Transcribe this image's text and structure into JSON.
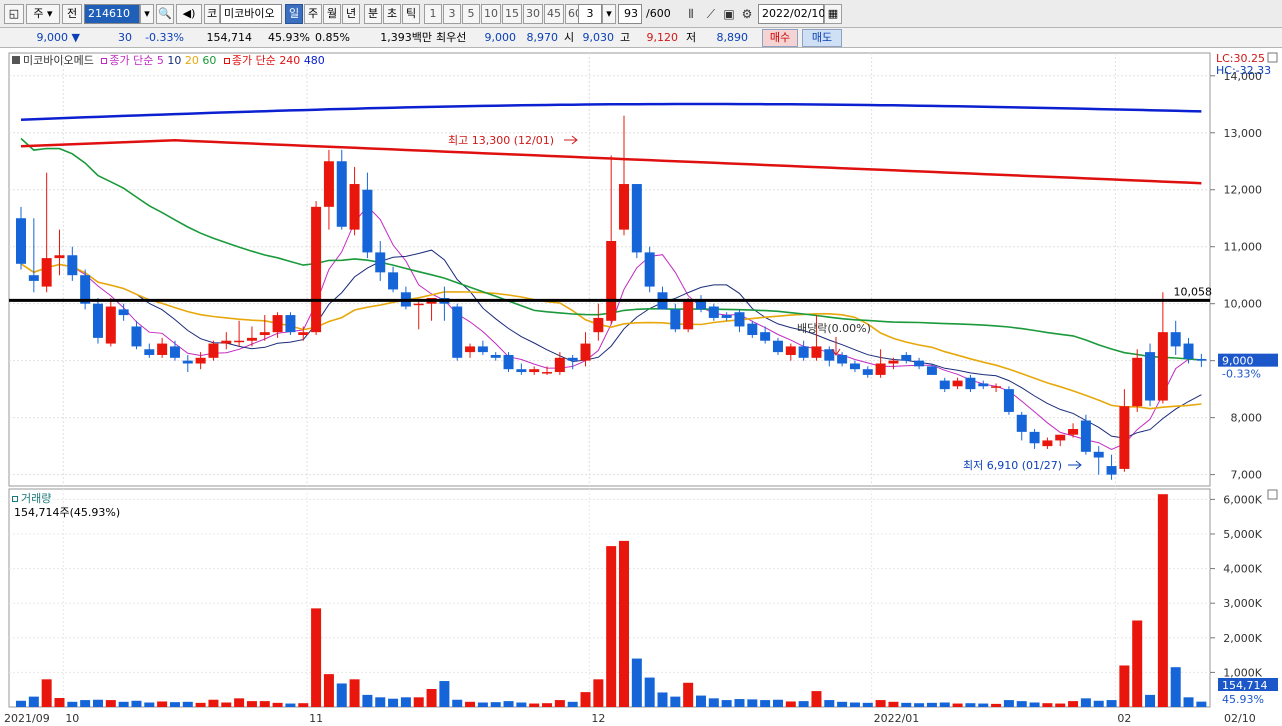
{
  "toolbar": {
    "mode_label": "주",
    "prev_label": "전",
    "stock_code": "214610",
    "market_label": "코",
    "stock_name": "미코바이오",
    "periods": [
      "일",
      "주",
      "월",
      "년",
      "분",
      "초",
      "틱"
    ],
    "selected_period": "일",
    "intervals": [
      "1",
      "3",
      "5",
      "10",
      "15",
      "30",
      "45",
      "60"
    ],
    "interval_value": "3",
    "count_value": "93",
    "count_total": "/600",
    "date": "2022/02/10"
  },
  "quote": {
    "price": "9,000",
    "change_arrow": "▼",
    "change": "30",
    "change_pct": "-0.33%",
    "volume": "154,714",
    "volume_ratio": "45.93%",
    "turnover": "0.85%",
    "amount": "1,393백만",
    "ask_label": "최우선",
    "ask1": "9,000",
    "ask2": "8,970",
    "open_label": "시",
    "open": "9,030",
    "high_label": "고",
    "high": "9,120",
    "low_label": "저",
    "low": "8,890",
    "buy_label": "매수",
    "sell_label": "매도"
  },
  "legend": {
    "name": "미코바이오메드",
    "ma_short_label": "종가 단순",
    "ma_short_periods": [
      "5",
      "10",
      "20",
      "60"
    ],
    "ma_long_label": "종가 단순",
    "ma_long_periods": [
      "240",
      "480"
    ],
    "lc": "LC:30.25",
    "hc": "HC:-32.33",
    "volume_title": "거래량",
    "volume_value": "154,714주(45.93%)"
  },
  "annotations": {
    "high": "최고 13,300 (12/01)",
    "low": "최저 6,910 (01/27)",
    "dividend": "배당락(0.00%)",
    "level_line": "10,058",
    "price_tag": "9,000",
    "price_tag_pct": "-0.33%",
    "vol_tag": "154,714",
    "vol_tag_pct": "45.93%"
  },
  "colors": {
    "up": "#e8160c",
    "down": "#1565d8",
    "ma5": "#c22bc2",
    "ma10": "#1a2b7a",
    "ma20": "#e8a80c",
    "ma60": "#1a9a3a",
    "ma240": "#e01010",
    "ma480": "#0b20d0"
  },
  "chart_data": {
    "type": "candlestick",
    "price_axis": {
      "ylim": [
        6800,
        14400
      ],
      "ticks": [
        7000,
        8000,
        9000,
        10000,
        11000,
        12000,
        13000,
        14000
      ]
    },
    "volume_axis": {
      "ylim": [
        0,
        6300
      ],
      "unit": "K",
      "ticks": [
        1000,
        2000,
        3000,
        4000,
        5000,
        6000
      ],
      "tick_labels": [
        "1,000K",
        "2,000K",
        "3,000K",
        "4,000K",
        "5,000K",
        "6,000K"
      ]
    },
    "date_labels": [
      {
        "index": 0,
        "label": "2021/09"
      },
      {
        "index": 4,
        "label": "10"
      },
      {
        "index": 23,
        "label": "11"
      },
      {
        "index": 45,
        "label": "12"
      },
      {
        "index": 67,
        "label": "2022/01"
      },
      {
        "index": 86,
        "label": "02"
      },
      {
        "index": 93,
        "label": "02/10"
      }
    ],
    "candles": [
      {
        "o": 11500,
        "h": 11700,
        "l": 10600,
        "c": 10700,
        "v": 180
      },
      {
        "o": 10500,
        "h": 11500,
        "l": 10200,
        "c": 10400,
        "v": 300
      },
      {
        "o": 10300,
        "h": 12300,
        "l": 10200,
        "c": 10800,
        "v": 800
      },
      {
        "o": 10800,
        "h": 11300,
        "l": 10500,
        "c": 10850,
        "v": 260
      },
      {
        "o": 10850,
        "h": 11000,
        "l": 10400,
        "c": 10500,
        "v": 150
      },
      {
        "o": 10500,
        "h": 10600,
        "l": 9900,
        "c": 10000,
        "v": 200
      },
      {
        "o": 10000,
        "h": 10100,
        "l": 9300,
        "c": 9400,
        "v": 210
      },
      {
        "o": 9300,
        "h": 10100,
        "l": 9250,
        "c": 9950,
        "v": 200
      },
      {
        "o": 9900,
        "h": 10000,
        "l": 9700,
        "c": 9800,
        "v": 150
      },
      {
        "o": 9600,
        "h": 9700,
        "l": 9200,
        "c": 9250,
        "v": 180
      },
      {
        "o": 9200,
        "h": 9300,
        "l": 9050,
        "c": 9100,
        "v": 130
      },
      {
        "o": 9100,
        "h": 9400,
        "l": 9050,
        "c": 9300,
        "v": 160
      },
      {
        "o": 9250,
        "h": 9350,
        "l": 9000,
        "c": 9050,
        "v": 140
      },
      {
        "o": 9000,
        "h": 9100,
        "l": 8800,
        "c": 8950,
        "v": 150
      },
      {
        "o": 8950,
        "h": 9150,
        "l": 8850,
        "c": 9050,
        "v": 120
      },
      {
        "o": 9050,
        "h": 9350,
        "l": 9000,
        "c": 9300,
        "v": 210
      },
      {
        "o": 9300,
        "h": 9500,
        "l": 9200,
        "c": 9350,
        "v": 130
      },
      {
        "o": 9350,
        "h": 9700,
        "l": 9250,
        "c": 9350,
        "v": 250
      },
      {
        "o": 9350,
        "h": 9600,
        "l": 9250,
        "c": 9400,
        "v": 170
      },
      {
        "o": 9450,
        "h": 9800,
        "l": 9350,
        "c": 9500,
        "v": 170
      },
      {
        "o": 9500,
        "h": 9850,
        "l": 9400,
        "c": 9800,
        "v": 120
      },
      {
        "o": 9800,
        "h": 9850,
        "l": 9450,
        "c": 9500,
        "v": 100
      },
      {
        "o": 9450,
        "h": 9600,
        "l": 9350,
        "c": 9500,
        "v": 110
      },
      {
        "o": 9500,
        "h": 11800,
        "l": 9450,
        "c": 11700,
        "v": 2850
      },
      {
        "o": 11700,
        "h": 12700,
        "l": 11300,
        "c": 12500,
        "v": 950
      },
      {
        "o": 12500,
        "h": 12700,
        "l": 11300,
        "c": 11350,
        "v": 680
      },
      {
        "o": 11300,
        "h": 12400,
        "l": 11200,
        "c": 12100,
        "v": 800
      },
      {
        "o": 12000,
        "h": 12300,
        "l": 10800,
        "c": 10900,
        "v": 350
      },
      {
        "o": 10900,
        "h": 11100,
        "l": 10400,
        "c": 10550,
        "v": 280
      },
      {
        "o": 10550,
        "h": 10650,
        "l": 10200,
        "c": 10250,
        "v": 240
      },
      {
        "o": 10200,
        "h": 10300,
        "l": 9900,
        "c": 9950,
        "v": 280
      },
      {
        "o": 10000,
        "h": 10050,
        "l": 9550,
        "c": 10000,
        "v": 280
      },
      {
        "o": 10000,
        "h": 10100,
        "l": 9700,
        "c": 10100,
        "v": 520
      },
      {
        "o": 10100,
        "h": 10300,
        "l": 9700,
        "c": 10000,
        "v": 750
      },
      {
        "o": 9950,
        "h": 10000,
        "l": 9000,
        "c": 9050,
        "v": 210
      },
      {
        "o": 9150,
        "h": 9300,
        "l": 9050,
        "c": 9250,
        "v": 150
      },
      {
        "o": 9250,
        "h": 9350,
        "l": 9100,
        "c": 9150,
        "v": 130
      },
      {
        "o": 9100,
        "h": 9150,
        "l": 9000,
        "c": 9050,
        "v": 140
      },
      {
        "o": 9100,
        "h": 9150,
        "l": 8800,
        "c": 8850,
        "v": 170
      },
      {
        "o": 8850,
        "h": 8950,
        "l": 8750,
        "c": 8800,
        "v": 130
      },
      {
        "o": 8800,
        "h": 8900,
        "l": 8750,
        "c": 8850,
        "v": 100
      },
      {
        "o": 8800,
        "h": 8900,
        "l": 8750,
        "c": 8800,
        "v": 110
      },
      {
        "o": 8800,
        "h": 9150,
        "l": 8750,
        "c": 9050,
        "v": 200
      },
      {
        "o": 9050,
        "h": 9100,
        "l": 8850,
        "c": 9000,
        "v": 150
      },
      {
        "o": 9000,
        "h": 9500,
        "l": 8900,
        "c": 9300,
        "v": 430
      },
      {
        "o": 9500,
        "h": 10000,
        "l": 9350,
        "c": 9750,
        "v": 800
      },
      {
        "o": 9700,
        "h": 12600,
        "l": 9650,
        "c": 11100,
        "v": 4650
      },
      {
        "o": 11300,
        "h": 13300,
        "l": 11200,
        "c": 12100,
        "v": 4800
      },
      {
        "o": 12100,
        "h": 12100,
        "l": 10800,
        "c": 10900,
        "v": 1400
      },
      {
        "o": 10900,
        "h": 11000,
        "l": 10200,
        "c": 10300,
        "v": 850
      },
      {
        "o": 10200,
        "h": 10300,
        "l": 9900,
        "c": 9900,
        "v": 420
      },
      {
        "o": 9900,
        "h": 10000,
        "l": 9500,
        "c": 9550,
        "v": 300
      },
      {
        "o": 9550,
        "h": 10100,
        "l": 9500,
        "c": 10050,
        "v": 700
      },
      {
        "o": 10050,
        "h": 10150,
        "l": 9850,
        "c": 9900,
        "v": 330
      },
      {
        "o": 9950,
        "h": 10000,
        "l": 9700,
        "c": 9750,
        "v": 250
      },
      {
        "o": 9800,
        "h": 9850,
        "l": 9700,
        "c": 9750,
        "v": 200
      },
      {
        "o": 9850,
        "h": 9900,
        "l": 9500,
        "c": 9600,
        "v": 230
      },
      {
        "o": 9650,
        "h": 9700,
        "l": 9400,
        "c": 9450,
        "v": 220
      },
      {
        "o": 9500,
        "h": 9600,
        "l": 9300,
        "c": 9350,
        "v": 200
      },
      {
        "o": 9350,
        "h": 9400,
        "l": 9100,
        "c": 9150,
        "v": 210
      },
      {
        "o": 9100,
        "h": 9300,
        "l": 9000,
        "c": 9250,
        "v": 160
      },
      {
        "o": 9250,
        "h": 9350,
        "l": 9000,
        "c": 9050,
        "v": 170
      },
      {
        "o": 9050,
        "h": 9800,
        "l": 9000,
        "c": 9250,
        "v": 460
      },
      {
        "o": 9200,
        "h": 9250,
        "l": 8900,
        "c": 9000,
        "v": 200
      },
      {
        "o": 9100,
        "h": 9150,
        "l": 8900,
        "c": 8950,
        "v": 150
      },
      {
        "o": 8950,
        "h": 9000,
        "l": 8800,
        "c": 8850,
        "v": 130
      },
      {
        "o": 8850,
        "h": 8900,
        "l": 8700,
        "c": 8750,
        "v": 120
      },
      {
        "o": 8750,
        "h": 9200,
        "l": 8700,
        "c": 8950,
        "v": 200
      },
      {
        "o": 8950,
        "h": 9050,
        "l": 8850,
        "c": 9000,
        "v": 150
      },
      {
        "o": 9100,
        "h": 9150,
        "l": 8950,
        "c": 9000,
        "v": 120
      },
      {
        "o": 9000,
        "h": 9050,
        "l": 8850,
        "c": 8900,
        "v": 110
      },
      {
        "o": 8900,
        "h": 8950,
        "l": 8750,
        "c": 8750,
        "v": 120
      },
      {
        "o": 8650,
        "h": 8700,
        "l": 8450,
        "c": 8500,
        "v": 130
      },
      {
        "o": 8550,
        "h": 8700,
        "l": 8500,
        "c": 8650,
        "v": 100
      },
      {
        "o": 8700,
        "h": 8750,
        "l": 8450,
        "c": 8500,
        "v": 110
      },
      {
        "o": 8600,
        "h": 8650,
        "l": 8500,
        "c": 8550,
        "v": 100
      },
      {
        "o": 8550,
        "h": 8600,
        "l": 8450,
        "c": 8550,
        "v": 90
      },
      {
        "o": 8500,
        "h": 8550,
        "l": 8050,
        "c": 8100,
        "v": 200
      },
      {
        "o": 8050,
        "h": 8100,
        "l": 7600,
        "c": 7750,
        "v": 170
      },
      {
        "o": 7750,
        "h": 7800,
        "l": 7450,
        "c": 7550,
        "v": 130
      },
      {
        "o": 7500,
        "h": 7650,
        "l": 7450,
        "c": 7600,
        "v": 110
      },
      {
        "o": 7600,
        "h": 7700,
        "l": 7500,
        "c": 7700,
        "v": 100
      },
      {
        "o": 7700,
        "h": 7900,
        "l": 7650,
        "c": 7800,
        "v": 170
      },
      {
        "o": 7950,
        "h": 8050,
        "l": 7350,
        "c": 7400,
        "v": 250
      },
      {
        "o": 7400,
        "h": 7500,
        "l": 7000,
        "c": 7300,
        "v": 180
      },
      {
        "o": 7150,
        "h": 7350,
        "l": 6910,
        "c": 7000,
        "v": 200
      },
      {
        "o": 7100,
        "h": 8500,
        "l": 7050,
        "c": 8200,
        "v": 1200
      },
      {
        "o": 8200,
        "h": 9200,
        "l": 8100,
        "c": 9050,
        "v": 2500
      },
      {
        "o": 9150,
        "h": 9300,
        "l": 8200,
        "c": 8300,
        "v": 350
      },
      {
        "o": 8300,
        "h": 10200,
        "l": 8250,
        "c": 9500,
        "v": 6150
      },
      {
        "o": 9500,
        "h": 9700,
        "l": 9100,
        "c": 9250,
        "v": 1150
      },
      {
        "o": 9300,
        "h": 9400,
        "l": 8950,
        "c": 9030,
        "v": 280
      },
      {
        "o": 9030,
        "h": 9120,
        "l": 8890,
        "c": 9000,
        "v": 155
      }
    ]
  }
}
